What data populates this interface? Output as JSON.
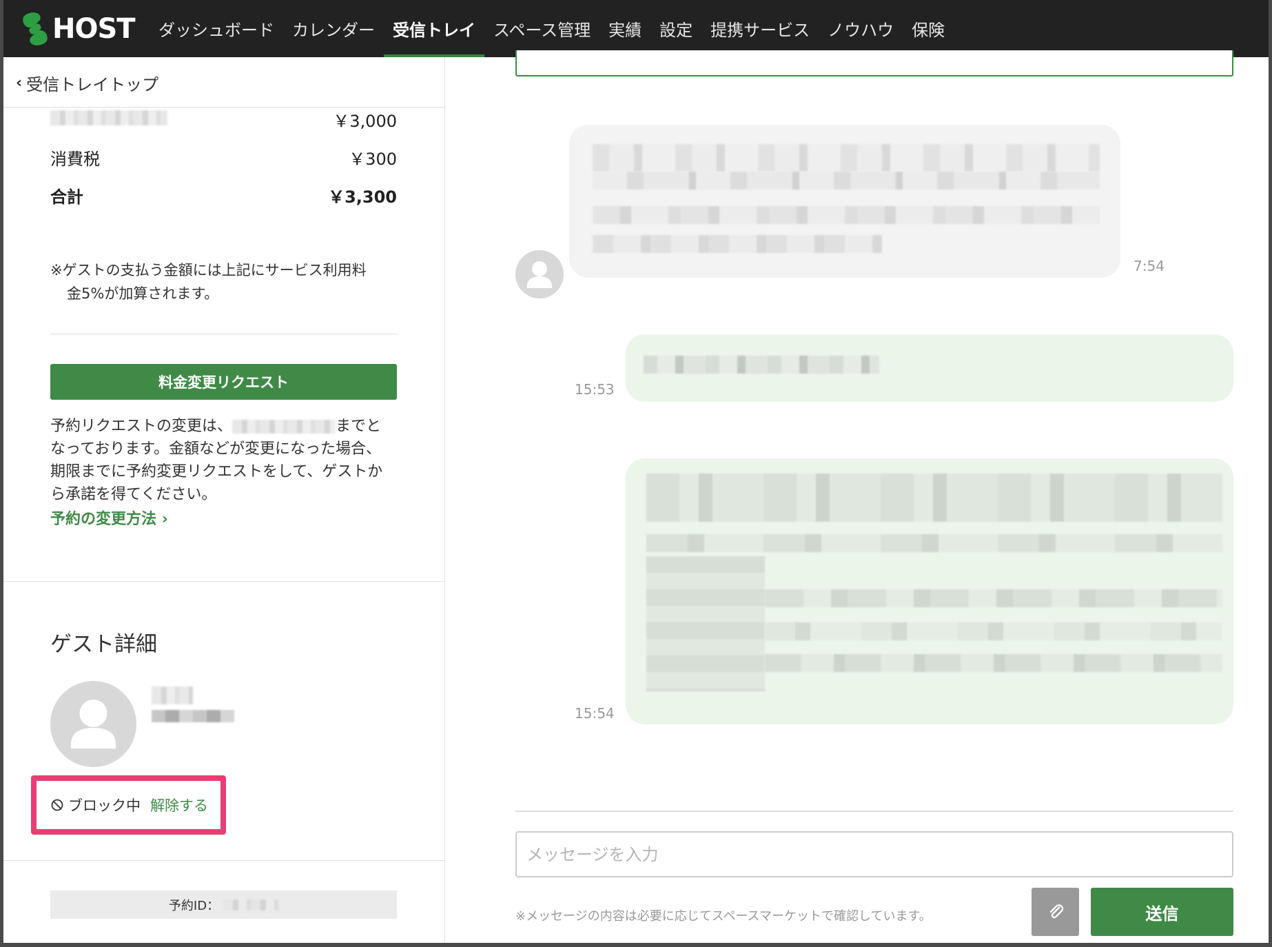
{
  "brand": {
    "logo_text": "HOST",
    "accent": "#3f8a47",
    "highlight": "#e83e73"
  },
  "nav": {
    "items": [
      "ダッシュボード",
      "カレンダー",
      "受信トレイ",
      "スペース管理",
      "実績",
      "設定",
      "提携サービス",
      "ノウハウ",
      "保険"
    ],
    "active": "受信トレイ"
  },
  "sidebar": {
    "back_label": "受信トレイトップ",
    "price_rows": [
      {
        "label": "",
        "amount": "￥3,000"
      },
      {
        "label": "消費税",
        "amount": "￥300"
      },
      {
        "label": "合計",
        "amount": "￥3,300"
      }
    ],
    "fee_note_line1": "※ゲストの支払う金額には上記にサービス利用料",
    "fee_note_line2": "金5%が加算されます。",
    "fee_change_button": "料金変更リクエスト",
    "change_note_part1": "予約リクエストの変更は、",
    "change_note_part2": "までと",
    "change_note_line2": "なっております。金額などが変更になった場合、",
    "change_note_line3": "期限までに予約変更リクエストをして、ゲストか",
    "change_note_line4": "ら承諾を得てください。",
    "change_howto_link": "予約の変更方法",
    "guest_section_title": "ゲスト詳細",
    "block_status": "ブロック中",
    "unblock_link": "解除する",
    "booking_id_label": "予約ID："
  },
  "chat": {
    "messages": [
      {
        "direction": "incoming",
        "time": "7:54"
      },
      {
        "direction": "outgoing",
        "time": "15:53"
      },
      {
        "direction": "outgoing",
        "time": "15:54"
      }
    ],
    "input_placeholder": "メッセージを入力",
    "note": "※メッセージの内容は必要に応じてスペースマーケットで確認しています。",
    "send_label": "送信",
    "attach_icon": "paperclip-icon"
  }
}
